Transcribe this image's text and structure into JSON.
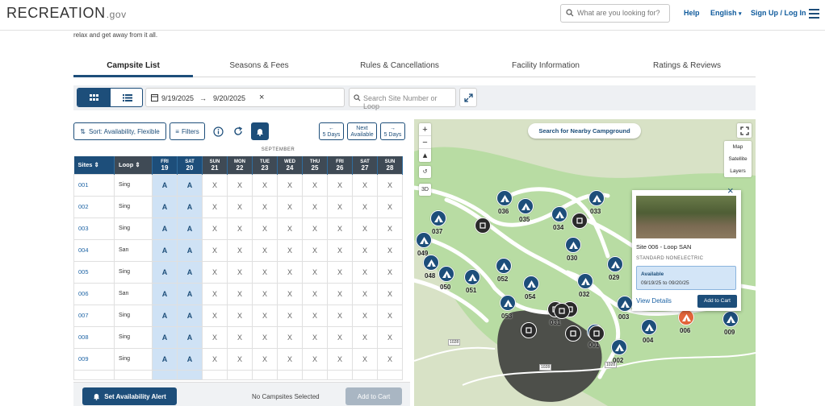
{
  "header": {
    "logo_main": "RECREATION",
    "logo_gov": ".gov",
    "search_placeholder": "What are you looking for?",
    "help": "Help",
    "language": "English",
    "signin": "Sign Up / Log In"
  },
  "intro_text": "relax and get away from it all.",
  "tabs": [
    "Campsite List",
    "Seasons & Fees",
    "Rules & Cancellations",
    "Facility Information",
    "Ratings & Reviews"
  ],
  "toolbar": {
    "start_date": "9/19/2025",
    "end_date": "9/20/2025",
    "site_search_placeholder": "Search Site Number or Loop"
  },
  "controls": {
    "sort_label": "Sort:  Availability, Flexible",
    "filters_label": "Filters",
    "prev_label": [
      "←",
      "5 Days"
    ],
    "next_avail_label": [
      "Next",
      "Available"
    ],
    "next_label": [
      "→",
      "5 Days"
    ]
  },
  "grid": {
    "month": "SEPTEMBER",
    "col_sites": "Sites",
    "col_loop": "Loop",
    "days": [
      {
        "dow": "FRI",
        "num": "19"
      },
      {
        "dow": "SAT",
        "num": "20"
      },
      {
        "dow": "SUN",
        "num": "21"
      },
      {
        "dow": "MON",
        "num": "22"
      },
      {
        "dow": "TUE",
        "num": "23"
      },
      {
        "dow": "WED",
        "num": "24"
      },
      {
        "dow": "THU",
        "num": "25"
      },
      {
        "dow": "FRI",
        "num": "26"
      },
      {
        "dow": "SAT",
        "num": "27"
      },
      {
        "dow": "SUN",
        "num": "28"
      }
    ],
    "rows": [
      {
        "site": "001",
        "loop": "Sing",
        "cells": [
          "A",
          "A",
          "X",
          "X",
          "X",
          "X",
          "X",
          "X",
          "X",
          "X"
        ]
      },
      {
        "site": "002",
        "loop": "Sing",
        "cells": [
          "A",
          "A",
          "X",
          "X",
          "X",
          "X",
          "X",
          "X",
          "X",
          "X"
        ]
      },
      {
        "site": "003",
        "loop": "Sing",
        "cells": [
          "A",
          "A",
          "X",
          "X",
          "X",
          "X",
          "X",
          "X",
          "X",
          "X"
        ]
      },
      {
        "site": "004",
        "loop": "San",
        "cells": [
          "A",
          "A",
          "X",
          "X",
          "X",
          "X",
          "X",
          "X",
          "X",
          "X"
        ]
      },
      {
        "site": "005",
        "loop": "Sing",
        "cells": [
          "A",
          "A",
          "X",
          "X",
          "X",
          "X",
          "X",
          "X",
          "X",
          "X"
        ]
      },
      {
        "site": "006",
        "loop": "San",
        "cells": [
          "A",
          "A",
          "X",
          "X",
          "X",
          "X",
          "X",
          "X",
          "X",
          "X"
        ]
      },
      {
        "site": "007",
        "loop": "Sing",
        "cells": [
          "A",
          "A",
          "X",
          "X",
          "X",
          "X",
          "X",
          "X",
          "X",
          "X"
        ]
      },
      {
        "site": "008",
        "loop": "Sing",
        "cells": [
          "A",
          "A",
          "X",
          "X",
          "X",
          "X",
          "X",
          "X",
          "X",
          "X"
        ]
      },
      {
        "site": "009",
        "loop": "Sing",
        "cells": [
          "A",
          "A",
          "X",
          "X",
          "X",
          "X",
          "X",
          "X",
          "X",
          "X"
        ]
      }
    ]
  },
  "bottom": {
    "alert_label": "Set Availability Alert",
    "no_selection": "No Campsites Selected",
    "add_to_cart": "Add to Cart"
  },
  "map": {
    "nearby_label": "Search for Nearby Campground",
    "layers": [
      "Map",
      "Satellite",
      "Layers"
    ],
    "three_d": "3D",
    "road_labels": [
      "1028",
      "1028",
      "1028"
    ],
    "site_labels": [
      "036",
      "035",
      "033",
      "034",
      "037",
      "049",
      "030",
      "029",
      "048",
      "050",
      "052",
      "054",
      "032",
      "051",
      "053",
      "031",
      "001",
      "003",
      "004",
      "006",
      "009",
      "002"
    ],
    "popup": {
      "title": "Site 006 - Loop SAN",
      "type": "STANDARD NONELECTRIC",
      "status": "Available",
      "dates": "09/19/25 to 09/20/25",
      "details_link": "View Details",
      "add_to_cart": "Add to Cart"
    }
  }
}
